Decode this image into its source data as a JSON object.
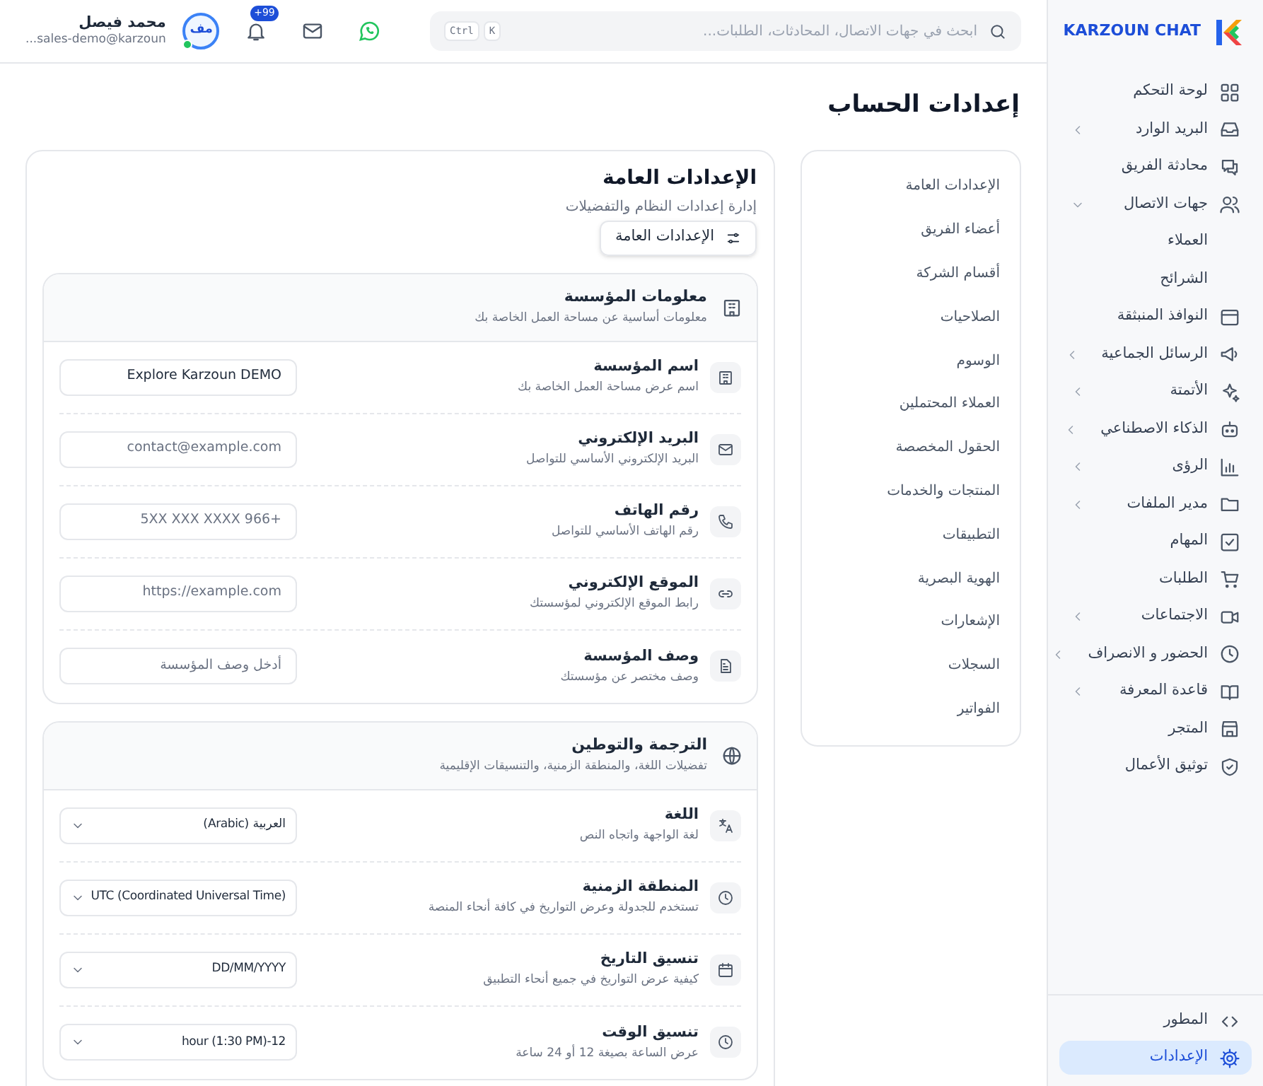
{
  "sidebar": {
    "brand": "KARZOUN CHAT",
    "items": [
      {
        "label": "لوحة التحكم",
        "selected": false
      },
      {
        "label": "البريد الوارد",
        "selected": false,
        "expanded": false
      },
      {
        "label": "محادثة الفريق",
        "selected": false
      },
      {
        "label": "جهات الاتصال",
        "selected": false,
        "expanded": true,
        "children": [
          {
            "label": "العملاء",
            "selected": false
          },
          {
            "label": "الشرائح",
            "selected": false
          }
        ]
      },
      {
        "label": "النوافذ المنبثقة",
        "selected": false
      },
      {
        "label": "الرسائل الجماعية",
        "selected": false,
        "expanded": false
      },
      {
        "label": "الأتمتة",
        "selected": false,
        "expanded": false
      },
      {
        "label": "الذكاء الاصطناعي",
        "selected": false,
        "expanded": false
      },
      {
        "label": "الرؤى",
        "selected": false,
        "expanded": false
      },
      {
        "label": "مدير الملفات",
        "selected": false,
        "expanded": false
      },
      {
        "label": "المهام",
        "selected": false
      },
      {
        "label": "الطلبات",
        "selected": false
      },
      {
        "label": "الاجتماعات",
        "selected": false,
        "expanded": false
      },
      {
        "label": "الحضور و الانصراف",
        "selected": false,
        "expanded": false
      },
      {
        "label": "قاعدة المعرفة",
        "selected": false,
        "expanded": false
      },
      {
        "label": "المتجر",
        "selected": false
      },
      {
        "label": "توثيق الأعمال",
        "selected": false
      }
    ],
    "footer_items": [
      {
        "label": "المطور",
        "selected": false
      },
      {
        "label": "الإعدادات",
        "selected": true
      }
    ]
  },
  "topbar": {
    "search": {
      "placeholder": "ابحث في جهات الاتصال، المحادثات، الطلبات...",
      "shortcut": [
        "K",
        "Ctrl"
      ]
    },
    "notifications_badge": "+99",
    "user": {
      "initials": "مف",
      "online": true,
      "name": "محمد فيصل",
      "email": "sales-demo@karzoun..."
    }
  },
  "page_title": "إعدادات الحساب",
  "settings_nav": [
    {
      "label": "الإعدادات العامة",
      "selected": false
    },
    {
      "label": "أعضاء الفريق",
      "selected": false
    },
    {
      "label": "أقسام الشركة",
      "selected": false
    },
    {
      "label": "الصلاحيات",
      "selected": false
    },
    {
      "label": "الوسوم",
      "selected": false
    },
    {
      "label": "العملاء المحتملين",
      "selected": false
    },
    {
      "label": "الحقول المخصصة",
      "selected": false
    },
    {
      "label": "المنتجات والخدمات",
      "selected": false
    },
    {
      "label": "التطبيقات",
      "selected": false
    },
    {
      "label": "الهوية البصرية",
      "selected": false
    },
    {
      "label": "الإشعارات",
      "selected": false
    },
    {
      "label": "السجلات",
      "selected": false
    },
    {
      "label": "الفواتير",
      "selected": false
    }
  ],
  "panel": {
    "title": "الإعدادات العامة",
    "subtitle": "إدارة إعدادات النظام والتفضيلات",
    "button": "الإعدادات العامة",
    "sections": [
      {
        "title": "معلومات المؤسسة",
        "subtitle": "معلومات أساسية عن مساحة العمل الخاصة بك",
        "rows": [
          {
            "label": "اسم المؤسسة",
            "description": "اسم عرض مساحة العمل الخاصة بك",
            "kind": "input",
            "value": "Explore Karzoun DEMO"
          },
          {
            "label": "البريد الإلكتروني",
            "description": "البريد الإلكتروني الأساسي للتواصل",
            "kind": "input",
            "placeholder": "contact@example.com"
          },
          {
            "label": "رقم الهاتف",
            "description": "رقم الهاتف الأساسي للتواصل",
            "kind": "input",
            "placeholder": "5XX XXX XXXX 966+"
          },
          {
            "label": "الموقع الإلكتروني",
            "description": "رابط الموقع الإلكتروني لمؤسستك",
            "kind": "input",
            "placeholder": "https://example.com"
          },
          {
            "label": "وصف المؤسسة",
            "description": "وصف مختصر عن مؤسستك",
            "kind": "input",
            "placeholder": "أدخل وصف المؤسسة"
          }
        ]
      },
      {
        "title": "الترجمة والتوطين",
        "subtitle": "تفضيلات اللغة، والمنطقة الزمنية، والتنسيقات الإقليمية",
        "rows": [
          {
            "label": "اللغة",
            "description": "لغة الواجهة واتجاه النص",
            "kind": "select",
            "value": "العربية (Arabic)"
          },
          {
            "label": "المنطقة الزمنية",
            "description": "تستخدم للجدولة وعرض التواريخ في كافة أنحاء المنصة",
            "kind": "select",
            "value": "UTC (Coordinated Universal Time)"
          },
          {
            "label": "تنسيق التاريخ",
            "description": "كيفية عرض التواريخ في جميع أنحاء التطبيق",
            "kind": "select",
            "value": "DD/MM/YYYY"
          },
          {
            "label": "تنسيق الوقت",
            "description": "عرض الساعة بصيغة 12 أو 24 ساعة",
            "kind": "select",
            "value": "hour (1:30 PM)-12"
          }
        ]
      }
    ]
  }
}
